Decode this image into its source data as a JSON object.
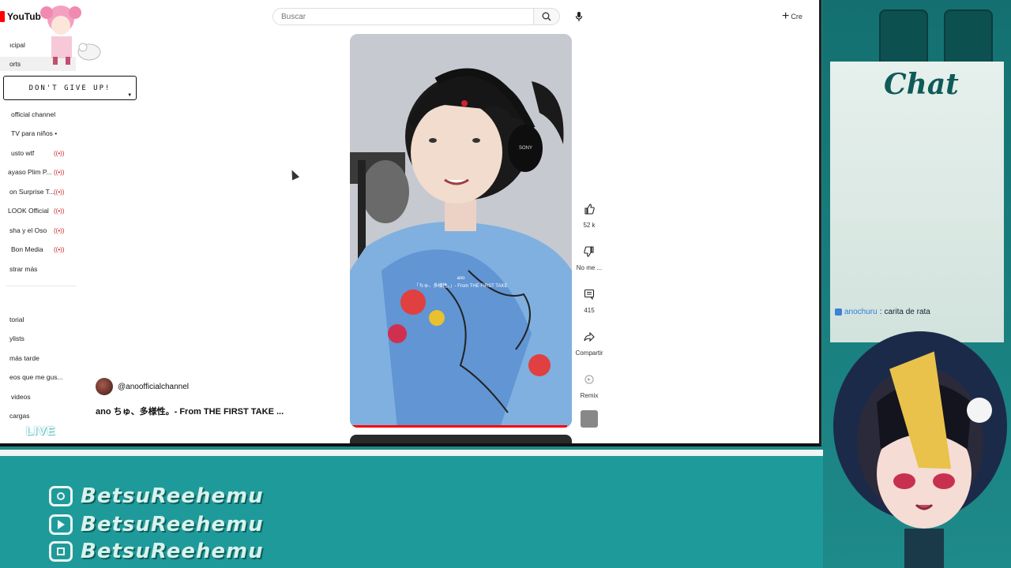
{
  "youtube": {
    "logo_text": "YouTub",
    "search_placeholder": "Buscar",
    "create_label": "Cre",
    "sidebar": {
      "items": [
        {
          "label": "ıcipal",
          "live": false
        },
        {
          "label": "orts",
          "live": false
        },
        {
          "label": "official channel",
          "live": false
        },
        {
          "label": "TV para niños •",
          "live": false
        },
        {
          "label": "usto wtf",
          "live": true
        },
        {
          "label": "ayaso Plim P...",
          "live": true
        },
        {
          "label": "on Surprise T...",
          "live": true
        },
        {
          "label": "LOOK Official",
          "live": true
        },
        {
          "label": "sha y el Oso",
          "live": true
        },
        {
          "label": "Bon Media",
          "live": true
        },
        {
          "label": "strar más",
          "live": false
        },
        {
          "label": "torial",
          "live": false
        },
        {
          "label": "ylists",
          "live": false
        },
        {
          "label": "más tarde",
          "live": false
        },
        {
          "label": "eos que me gus...",
          "live": false
        },
        {
          "label": "videos",
          "live": false
        },
        {
          "label": "cargas",
          "live": false
        }
      ],
      "live_icon": "((•))"
    },
    "short": {
      "channel": "@anoofficialchannel",
      "title": "ano  ちゅ、多様性。- From THE FIRST TAKE  ...",
      "caption_line1": "ano",
      "caption_line2": "「ちゅ、多様性。」- From THE FIRST TAKE",
      "progress": 0.98
    },
    "actions": {
      "like_count": "52 k",
      "dislike_label": "No me ...",
      "comments_count": "415",
      "share_label": "Compartir",
      "remix_label": "Remix"
    }
  },
  "overlay": {
    "bubble_text": "DON'T GIVE UP!",
    "live_badge": "LIVE",
    "chat_title": "Chat",
    "chat_message": {
      "user": "anochuru",
      "separator": ":",
      "text": "carita de rata"
    },
    "socials": [
      {
        "icon": "instagram-icon",
        "name": "BetsuReehemu"
      },
      {
        "icon": "youtube-icon",
        "name": "BetsuReehemu"
      },
      {
        "icon": "twitch-icon",
        "name": "BetsuReehemu"
      }
    ]
  }
}
